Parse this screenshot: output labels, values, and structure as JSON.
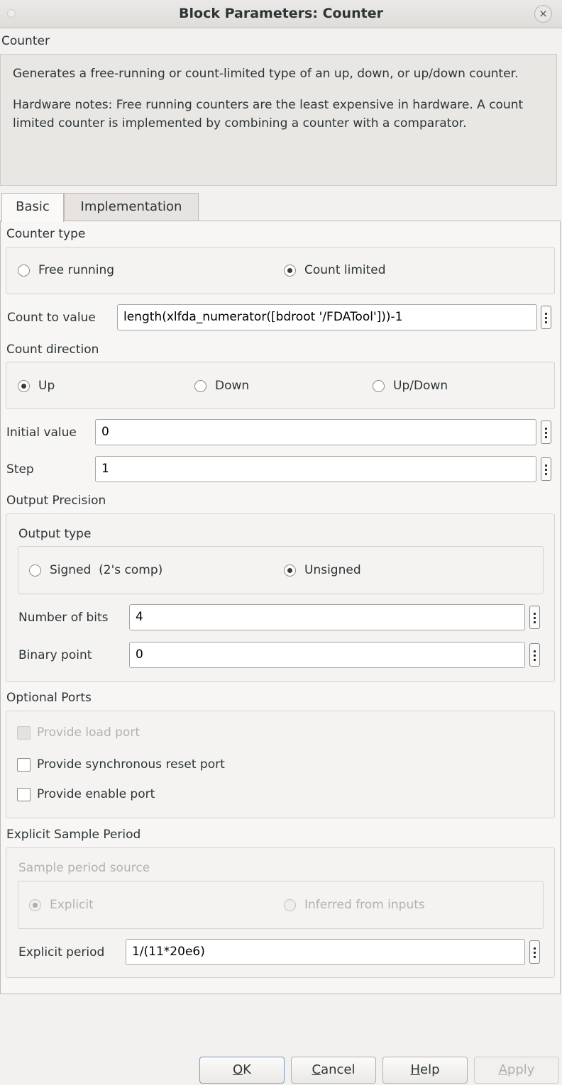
{
  "window": {
    "title": "Block Parameters: Counter",
    "close_glyph": "×"
  },
  "block_name": "Counter",
  "description": {
    "line1": "Generates a free-running or count-limited type of an up, down, or up/down counter.",
    "line2": "Hardware notes: Free running counters are the least expensive in hardware. A count limited counter is implemented by combining a counter with a comparator."
  },
  "tabs": [
    {
      "label": "Basic",
      "active": true
    },
    {
      "label": "Implementation",
      "active": false
    }
  ],
  "counter_type": {
    "heading": "Counter type",
    "options": [
      {
        "label": "Free running",
        "selected": false
      },
      {
        "label": "Count limited",
        "selected": true
      }
    ]
  },
  "count_to_value": {
    "label": "Count to value",
    "value": "length(xlfda_numerator([bdroot '/FDATool']))-1"
  },
  "count_direction": {
    "heading": "Count direction",
    "options": [
      {
        "label": "Up",
        "selected": true
      },
      {
        "label": "Down",
        "selected": false
      },
      {
        "label": "Up/Down",
        "selected": false
      }
    ]
  },
  "initial_value": {
    "label": "Initial value",
    "value": "0"
  },
  "step": {
    "label": "Step",
    "value": "1"
  },
  "output_precision": {
    "heading": "Output Precision",
    "output_type": {
      "heading": "Output type",
      "options": [
        {
          "label": "Signed  (2's comp)",
          "selected": false
        },
        {
          "label": "Unsigned",
          "selected": true
        }
      ]
    },
    "number_of_bits": {
      "label": "Number of bits",
      "value": "4"
    },
    "binary_point": {
      "label": "Binary point",
      "value": "0"
    }
  },
  "optional_ports": {
    "heading": "Optional Ports",
    "items": [
      {
        "label": "Provide load port",
        "checked": false,
        "enabled": false
      },
      {
        "label": "Provide synchronous reset port",
        "checked": false,
        "enabled": true
      },
      {
        "label": "Provide enable port",
        "checked": false,
        "enabled": true
      }
    ]
  },
  "explicit_sample_period": {
    "heading": "Explicit Sample Period",
    "source": {
      "heading": "Sample period source",
      "options": [
        {
          "label": "Explicit",
          "selected": true
        },
        {
          "label": "Inferred from inputs",
          "selected": false
        }
      ]
    },
    "explicit_period": {
      "label": "Explicit period",
      "value": "1/(11*20e6)"
    }
  },
  "buttons": {
    "ok": {
      "mnemonic": "O",
      "rest": "K"
    },
    "cancel": {
      "mnemonic": "C",
      "rest": "ancel"
    },
    "help": {
      "mnemonic": "H",
      "rest": "elp"
    },
    "apply": {
      "mnemonic": "A",
      "rest": "pply"
    }
  }
}
